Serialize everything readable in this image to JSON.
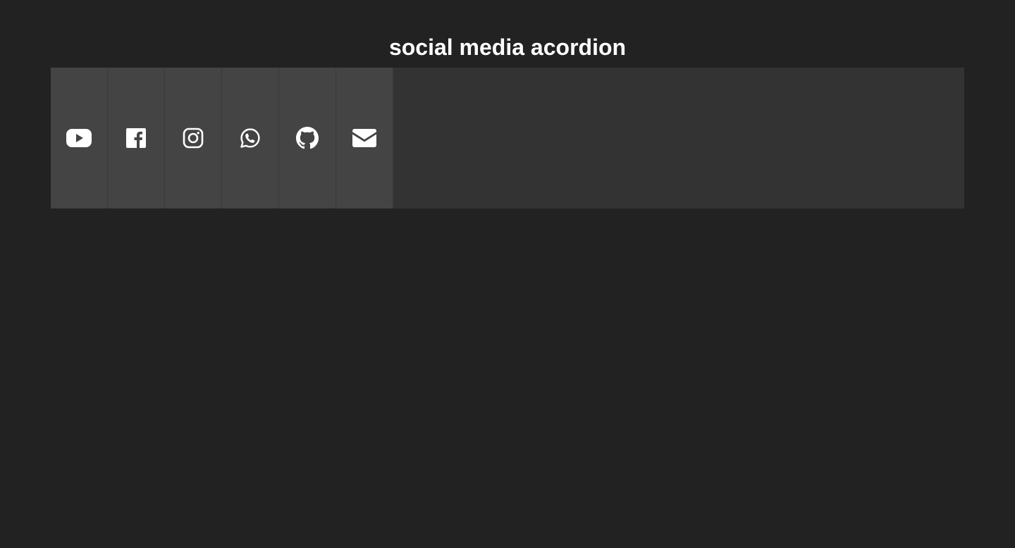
{
  "page": {
    "title": "social media acordion",
    "background_color": "#222222",
    "accordion_background": "#333333",
    "panel_color": "#444444",
    "icon_color": "#ffffff"
  },
  "accordion": {
    "items": [
      {
        "id": "youtube",
        "icon": "youtube-icon"
      },
      {
        "id": "facebook",
        "icon": "facebook-icon"
      },
      {
        "id": "instagram",
        "icon": "instagram-icon"
      },
      {
        "id": "whatsapp",
        "icon": "whatsapp-icon"
      },
      {
        "id": "github",
        "icon": "github-icon"
      },
      {
        "id": "email",
        "icon": "envelope-icon"
      }
    ]
  }
}
